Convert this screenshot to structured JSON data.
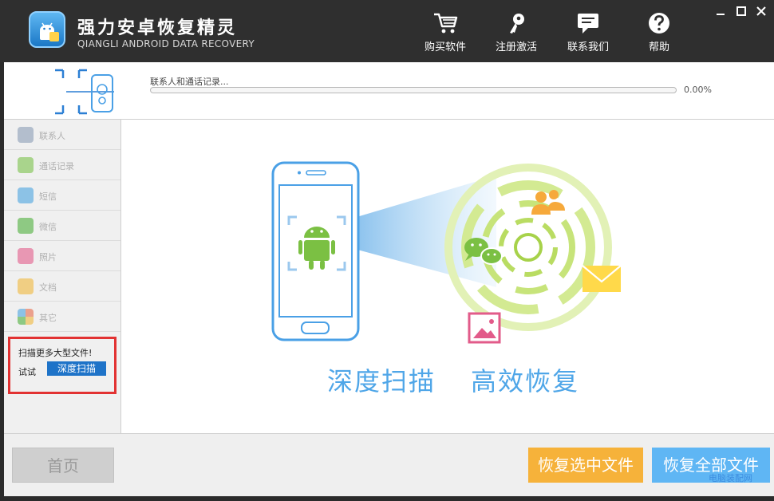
{
  "app": {
    "title_cn": "强力安卓恢复精灵",
    "title_en": "QIANGLI ANDROID DATA RECOVERY",
    "logo_icon": "android-robot-logo-icon"
  },
  "header": {
    "buttons": [
      {
        "label": "购买软件",
        "icon": "shopping-cart-icon"
      },
      {
        "label": "注册激活",
        "icon": "key-icon"
      },
      {
        "label": "联系我们",
        "icon": "chat-bubble-icon"
      },
      {
        "label": "帮助",
        "icon": "help-question-icon"
      }
    ],
    "window_controls": [
      "minimize-icon",
      "maximize-icon",
      "close-icon"
    ]
  },
  "scan": {
    "status": "联系人和通话记录...",
    "percent_text": "0.00%",
    "progress": 0.0
  },
  "sidebar": {
    "items": [
      {
        "label": "联系人",
        "icon": "contacts-icon",
        "color": "#8a9db5"
      },
      {
        "label": "通话记录",
        "icon": "phone-call-icon",
        "color": "#7ac24a"
      },
      {
        "label": "短信",
        "icon": "sms-icon",
        "color": "#4aa4e0"
      },
      {
        "label": "微信",
        "icon": "wechat-icon",
        "color": "#4caf3a"
      },
      {
        "label": "照片",
        "icon": "photo-icon",
        "color": "#e25b8a"
      },
      {
        "label": "文档",
        "icon": "document-icon",
        "color": "#f0b83a"
      },
      {
        "label": "其它",
        "icon": "others-icon",
        "color": "#e86a4a"
      }
    ],
    "promo": {
      "line1": "扫描更多大型文件!",
      "try_label": "试试",
      "deep_scan_label": "深度扫描"
    }
  },
  "main": {
    "caption_left": "深度扫描",
    "caption_right": "高效恢复"
  },
  "footer": {
    "home_label": "首页",
    "recover_selected_label": "恢复选中文件",
    "recover_all_label": "恢复全部文件",
    "watermark": "电脑装配网"
  },
  "colors": {
    "accent_blue": "#4fa6e8",
    "orange": "#f6b23a",
    "light_blue": "#5fb6f4",
    "promo_border": "#e23232",
    "deep_scan_button": "#1e73c8"
  }
}
